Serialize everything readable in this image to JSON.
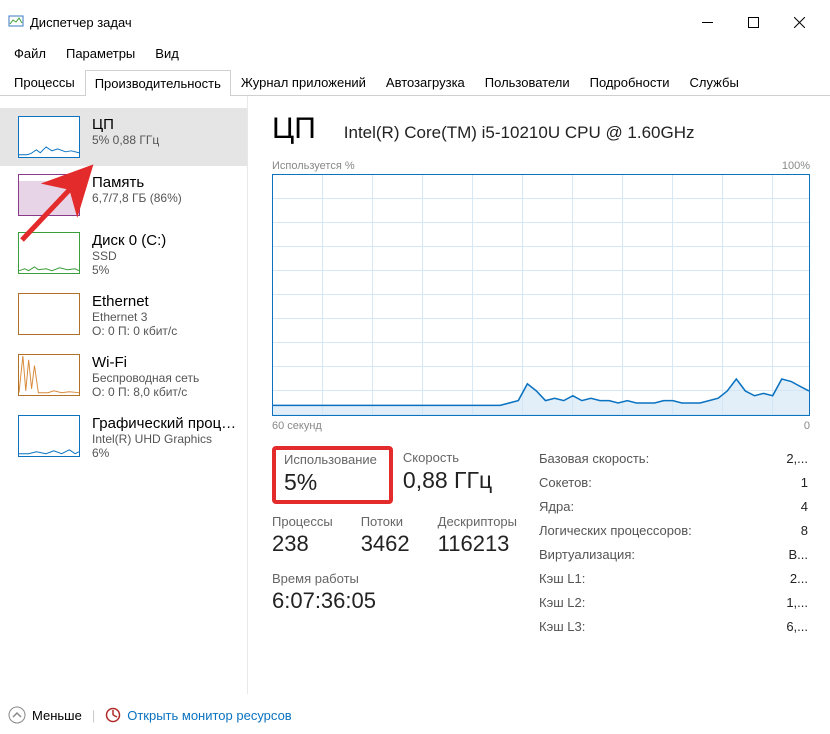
{
  "window": {
    "title": "Диспетчер задач"
  },
  "menu": {
    "file": "Файл",
    "options": "Параметры",
    "view": "Вид"
  },
  "tabs": {
    "processes": "Процессы",
    "performance": "Производительность",
    "app_history": "Журнал приложений",
    "startup": "Автозагрузка",
    "users": "Пользователи",
    "details": "Подробности",
    "services": "Службы"
  },
  "sidebar": {
    "cpu": {
      "title": "ЦП",
      "sub": "5% 0,88 ГГц"
    },
    "memory": {
      "title": "Память",
      "sub": "6,7/7,8 ГБ (86%)"
    },
    "disk": {
      "title": "Диск 0 (C:)",
      "sub": "SSD",
      "sub2": "5%"
    },
    "ethernet": {
      "title": "Ethernet",
      "sub": "Ethernet 3",
      "sub2": "О: 0 П: 0 кбит/с"
    },
    "wifi": {
      "title": "Wi-Fi",
      "sub": "Беспроводная сеть",
      "sub2": "О: 0 П: 8,0 кбит/с"
    },
    "gpu": {
      "title": "Графический процессор",
      "sub": "Intel(R) UHD Graphics",
      "sub2": "6%"
    }
  },
  "detail": {
    "title": "ЦП",
    "subtitle": "Intel(R) Core(TM) i5-10210U CPU @ 1.60GHz",
    "chart_ylabel": "Используется %",
    "chart_ymax": "100%",
    "chart_xleft": "60 секунд",
    "chart_xright": "0"
  },
  "stats": {
    "utilization_label": "Использование",
    "utilization_value": "5%",
    "speed_label": "Скорость",
    "speed_value": "0,88 ГГц",
    "processes_label": "Процессы",
    "processes_value": "238",
    "threads_label": "Потоки",
    "threads_value": "3462",
    "handles_label": "Дескрипторы",
    "handles_value": "116213",
    "uptime_label": "Время работы",
    "uptime_value": "6:07:36:05"
  },
  "info": {
    "base_speed_label": "Базовая скорость:",
    "base_speed_value": "2,...",
    "sockets_label": "Сокетов:",
    "sockets_value": "1",
    "cores_label": "Ядра:",
    "cores_value": "4",
    "logical_label": "Логических процессоров:",
    "logical_value": "8",
    "virt_label": "Виртуализация:",
    "virt_value": "В...",
    "l1_label": "Кэш L1:",
    "l1_value": "2...",
    "l2_label": "Кэш L2:",
    "l2_value": "1,...",
    "l3_label": "Кэш L3:",
    "l3_value": "6,..."
  },
  "footer": {
    "collapse": "Меньше",
    "resmon": "Открыть монитор ресурсов"
  },
  "chart_data": {
    "type": "line",
    "ylabel": "Используется %",
    "ylim": [
      0,
      100
    ],
    "xlabel": "секунд",
    "xlim": [
      60,
      0
    ],
    "series": [
      {
        "name": "CPU",
        "values": [
          4,
          4,
          4,
          4,
          4,
          4,
          4,
          4,
          4,
          4,
          4,
          4,
          4,
          4,
          4,
          4,
          4,
          4,
          4,
          4,
          4,
          4,
          4,
          4,
          4,
          4,
          5,
          6,
          13,
          10,
          6,
          7,
          6,
          8,
          6,
          7,
          6,
          6,
          5,
          6,
          5,
          5,
          5,
          6,
          6,
          5,
          5,
          5,
          6,
          7,
          10,
          15,
          10,
          8,
          9,
          8,
          15,
          14,
          12,
          10
        ]
      }
    ]
  }
}
